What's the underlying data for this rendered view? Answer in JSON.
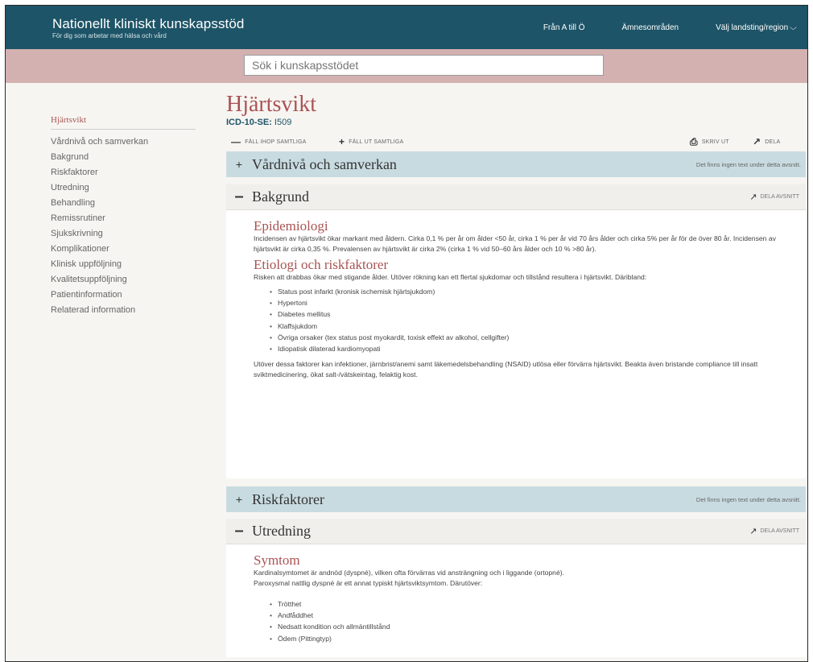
{
  "header": {
    "brand_title": "Nationellt kliniskt kunskapsstöd",
    "brand_sub": "För dig som arbetar med hälsa och vård",
    "nav": [
      "Från A till Ö",
      "Ämnesområden",
      "Välj landsting/region"
    ],
    "accent": "#1d5467",
    "band_color": "#d3b1b0"
  },
  "search": {
    "placeholder": "Sök i kunskapsstödet"
  },
  "sidebar": {
    "heading": "Hjärtsvikt",
    "items": [
      "Vårdnivå och samverkan",
      "Bakgrund",
      "Riskfaktorer",
      "Utredning",
      "Behandling",
      "Remissrutiner",
      "Sjukskrivning",
      "Komplikationer",
      "Klinisk uppföljning",
      "Kvalitetsuppföljning",
      "Patientinformation",
      "Relaterad information"
    ]
  },
  "page": {
    "title": "Hjärtsvikt",
    "icd_label": "ICD-10-SE:",
    "icd_code": "I509",
    "collapse_all": "Fäll ihop samtliga",
    "expand_all": "Fäll ut samtliga",
    "print": "Skriv ut",
    "share": "Dela"
  },
  "sections": {
    "vardniva": {
      "title": "Vårdnivå och samverkan",
      "note": "Det finns ingen text under detta avsnitt."
    },
    "bakgrund": {
      "title": "Bakgrund",
      "share": "Dela avsnitt",
      "epi_title": "Epidemiologi",
      "epi_text": "Incidensen av hjärtsvikt ökar markant med åldern. Cirka 0,1 % per år om ålder <50 år, cirka 1 % per år vid 70 års ålder och cirka  5% per år för de över 80 år. Incidensen av hjärtsvikt är cirka 0,35 %. Prevalensen av hjärtsvikt är cirka 2% (cirka 1 % vid 50–60 års ålder och 10 % >80 år).",
      "etio_title": "Etiologi och riskfaktorer",
      "etio_text": "Risken att drabbas ökar med stigande ålder. Utöver rökning kan ett flertal sjukdomar och tillstånd resultera i hjärtsvikt. Däribland:",
      "etio_list": [
        "Status post infarkt (kronisk ischemisk hjärtsjukdom)",
        "Hypertoni",
        "Diabetes mellitus",
        "Klaffsjukdom",
        "Övriga orsaker (tex status post myokardit, toxisk effekt av alkohol, cellgifter)",
        "Idiopatisk dilaterad kardiomyopati"
      ],
      "extra_text": "Utöver dessa faktorer kan infektioner, järnbrist/anemi samt läkemedelsbehandling (NSAID) utlösa eller förvärra hjärtsvikt. Beakta även bristande compliance till insatt sviktmedicinering, ökat salt-/vätskeintag, felaktig kost."
    },
    "riskfaktorer": {
      "title": "Riskfaktorer",
      "note": "Det finns ingen text under detta avsnitt."
    },
    "utredning": {
      "title": "Utredning",
      "share": "Dela avsnitt",
      "sym_title": "Symtom",
      "sym_text_1": "Kardinalsymtomet är andnöd (dyspné), vilken ofta förvärras vid ansträngning och i liggande (ortopné).",
      "sym_text_2": "Paroxysmal nattlig dyspné är ett annat typiskt hjärtsviktsymtom. Därutöver:",
      "sym_list": [
        "Trötthet",
        "Andfåddhet",
        "Nedsatt kondition och allmäntillstånd",
        "Ödem (Pittingtyp)"
      ]
    }
  }
}
